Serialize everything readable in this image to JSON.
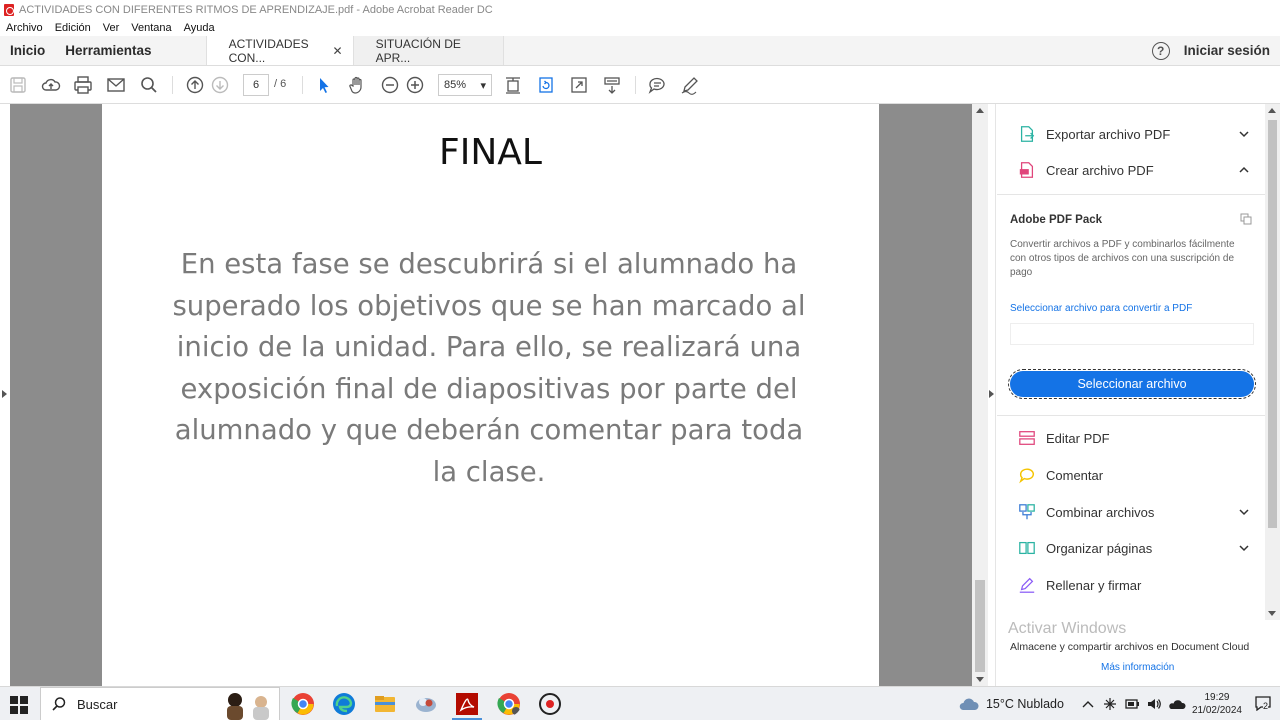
{
  "window": {
    "title": "ACTIVIDADES CON DIFERENTES RITMOS DE APRENDIZAJE.pdf - Adobe Acrobat Reader DC"
  },
  "menu": [
    "Archivo",
    "Edición",
    "Ver",
    "Ventana",
    "Ayuda"
  ],
  "nav": {
    "home": "Inicio",
    "tools": "Herramientas"
  },
  "tabs": [
    {
      "label": "ACTIVIDADES CON...",
      "close": "✕"
    },
    {
      "label": "SITUACIÓN DE APR..."
    }
  ],
  "account": {
    "help": "?",
    "signin": "Iniciar sesión"
  },
  "toolbar": {
    "page_current": "6",
    "page_total": "/ 6",
    "zoom": "85%",
    "zoom_caret": "▾"
  },
  "document": {
    "heading": "FINAL",
    "body": "En esta fase se descubrirá si el alumnado ha superado los objetivos que se han marcado al inicio de la unidad. Para ello, se realizará una exposición final de diapositivas por parte del alumnado y que deberán comentar para toda la clase."
  },
  "panel": {
    "export_pdf": "Exportar archivo PDF",
    "create_pdf": "Crear archivo PDF",
    "pack_title": "Adobe PDF Pack",
    "pack_desc": "Convertir archivos a PDF y combinarlos fácilmente con otros tipos de archivos con una suscripción de pago",
    "select_link": "Seleccionar archivo para convertir a PDF",
    "select_button": "Seleccionar archivo",
    "tools": [
      {
        "label": "Editar PDF",
        "color": "#e0457b"
      },
      {
        "label": "Comentar",
        "color": "#f5c400"
      },
      {
        "label": "Combinar archivos",
        "color": "#3a7bd5"
      },
      {
        "label": "Organizar páginas",
        "color": "#2bb3a3"
      },
      {
        "label": "Rellenar y firmar",
        "color": "#8b5cf6"
      }
    ],
    "activate_windows": "Activar Windows",
    "footer_text": "Almacene y compartir archivos en Document Cloud",
    "footer_link": "Más información"
  },
  "taskbar": {
    "search": "Buscar",
    "weather": "15°C  Nublado",
    "time": "19:29",
    "date": "21/02/2024",
    "notifications": "2"
  },
  "colors": {
    "accent": "#1473e6",
    "pdf_red": "#d22"
  }
}
